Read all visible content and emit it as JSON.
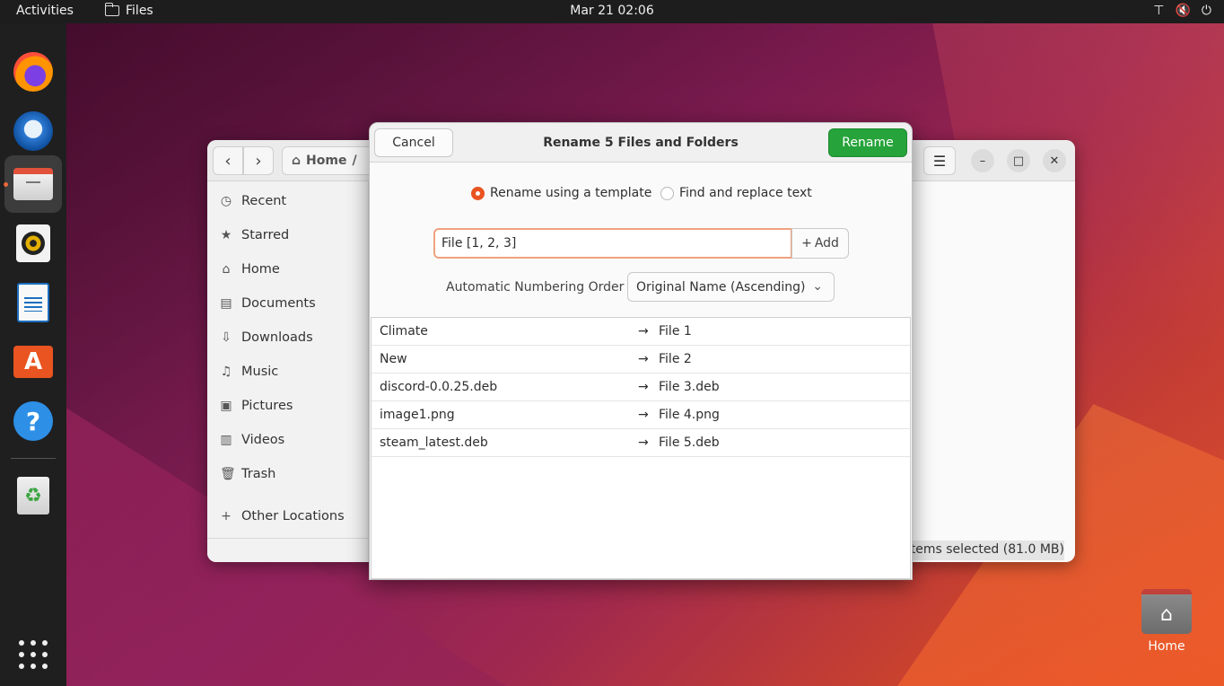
{
  "topbar": {
    "activities": "Activities",
    "app_name": "Files",
    "clock": "Mar 21  02:06",
    "tray_icons": [
      "network-icon",
      "volume-muted-icon",
      "power-icon"
    ]
  },
  "dock": {
    "apps": [
      "Firefox",
      "Thunderbird",
      "Files",
      "Rhythmbox",
      "LibreOffice Writer",
      "Ubuntu Software",
      "Help",
      "Trash"
    ],
    "active_app": "Files"
  },
  "files": {
    "path_home": "Home",
    "path_sep": "/",
    "sidebar": [
      {
        "label": "Recent",
        "icon": "clock-icon"
      },
      {
        "label": "Starred",
        "icon": "star-icon"
      },
      {
        "label": "Home",
        "icon": "home-icon"
      },
      {
        "label": "Documents",
        "icon": "document-icon"
      },
      {
        "label": "Downloads",
        "icon": "download-icon"
      },
      {
        "label": "Music",
        "icon": "music-icon"
      },
      {
        "label": "Pictures",
        "icon": "picture-icon"
      },
      {
        "label": "Videos",
        "icon": "video-icon"
      },
      {
        "label": "Trash",
        "icon": "trash-icon"
      }
    ],
    "other_locations": "Other Locations",
    "status": "items selected (81.0 MB)"
  },
  "dialog": {
    "cancel": "Cancel",
    "title": "Rename 5 Files and Folders",
    "rename": "Rename",
    "mode_template": "Rename using a template",
    "mode_find": "Find and replace text",
    "selected_mode": "template",
    "template_value": "File [1, 2, 3]",
    "add_label": "Add",
    "order_label": "Automatic Numbering Order",
    "order_value": "Original Name (Ascending)",
    "rows": [
      {
        "original": "Climate",
        "new": "File 1"
      },
      {
        "original": "New",
        "new": "File 2"
      },
      {
        "original": "discord-0.0.25.deb",
        "new": "File 3.deb"
      },
      {
        "original": "image1.png",
        "new": "File 4.png"
      },
      {
        "original": "steam_latest.deb",
        "new": "File 5.deb"
      }
    ],
    "arrow": "→"
  },
  "desktop": {
    "home_label": "Home"
  },
  "colors": {
    "accent": "#e95420",
    "rename_button": "#26a33a",
    "topbar": "#1d1d1d"
  }
}
